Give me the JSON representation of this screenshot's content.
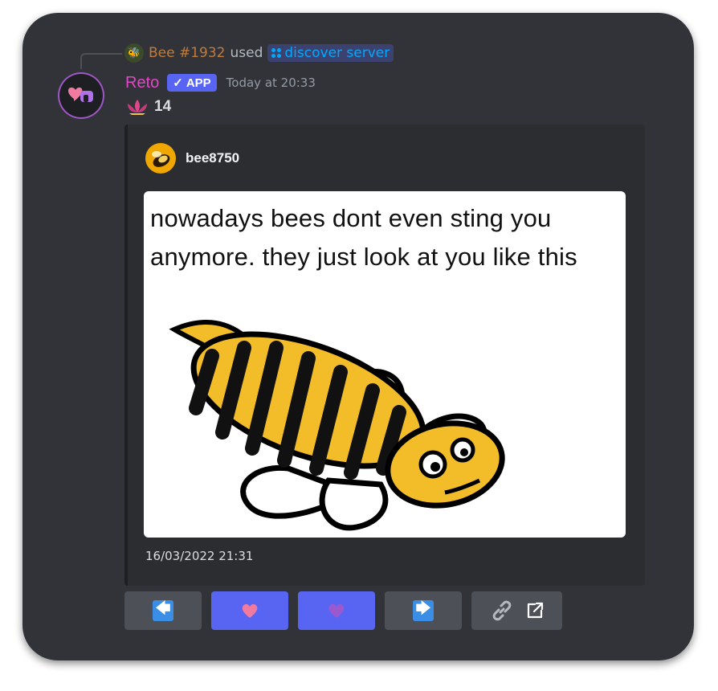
{
  "interaction": {
    "user": "Bee #1932",
    "used_text": "used",
    "command": "discover server"
  },
  "message": {
    "author": "Reto",
    "badge": "APP",
    "timestamp": "Today at 20:33",
    "reaction_count": "14"
  },
  "embed": {
    "author_name": "bee8750",
    "image_text": "nowadays bees dont even sting you anymore. they just look at you like this",
    "footer": "16/03/2022 21:31"
  },
  "buttons": [
    {
      "name": "previous-button",
      "icon": "arrow-left-icon"
    },
    {
      "name": "like-button",
      "icon": "heart-icon"
    },
    {
      "name": "superlike-button",
      "icon": "purple-heart-icon"
    },
    {
      "name": "next-button",
      "icon": "arrow-right-icon"
    },
    {
      "name": "link-button",
      "icon": "link-icon"
    }
  ],
  "colors": {
    "background": "#313338",
    "embed": "#2b2d31",
    "blurple": "#5865f2",
    "author": "#e048c8",
    "command": "#00a8fc"
  }
}
